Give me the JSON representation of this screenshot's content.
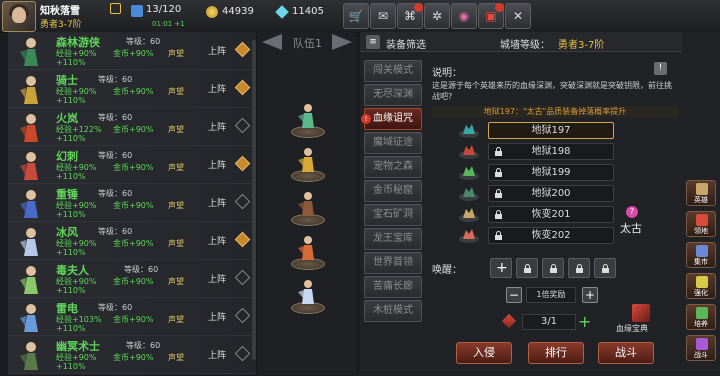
{
  "player": {
    "name": "知秋落雪",
    "difficulty": "勇者3-7阶",
    "energy": "13/120",
    "timer": "01:01 +1",
    "gold": "44939",
    "gems": "11405"
  },
  "toolbar": [
    "store",
    "mail",
    "gamepad",
    "settings",
    "palette",
    "gift",
    "tools"
  ],
  "heroes": [
    {
      "name": "森林游侠",
      "level": "等级：60",
      "exp": "经验+90%",
      "coin": "金币+90%",
      "fame": "声望",
      "extra": "+110%",
      "deploy": "上阵",
      "selected": true,
      "color": "#3a8a5a"
    },
    {
      "name": "骑士",
      "level": "等级：60",
      "exp": "经验+90%",
      "coin": "金币+90%",
      "fame": "声望",
      "extra": "+110%",
      "deploy": "上阵",
      "selected": true,
      "color": "#c9a23a"
    },
    {
      "name": "火岚",
      "level": "等级：60",
      "exp": "经验+122%",
      "coin": "金币+90%",
      "fame": "声望",
      "extra": "+110%",
      "deploy": "上阵",
      "selected": false,
      "color": "#c94a2a"
    },
    {
      "name": "幻刺",
      "level": "等级：60",
      "exp": "经验+90%",
      "coin": "金币+90%",
      "fame": "声望",
      "extra": "+110%",
      "deploy": "上阵",
      "selected": true,
      "color": "#c84a3a"
    },
    {
      "name": "重锤",
      "level": "等级：60",
      "exp": "经验+90%",
      "coin": "金币+90%",
      "fame": "声望",
      "extra": "+110%",
      "deploy": "上阵",
      "selected": false,
      "color": "#4a6ac8"
    },
    {
      "name": "冰风",
      "level": "等级：60",
      "exp": "经验+90%",
      "coin": "金币+90%",
      "fame": "声望",
      "extra": "+110%",
      "deploy": "上阵",
      "selected": true,
      "color": "#b8c8e8"
    },
    {
      "name": "毒夫人",
      "level": "等级：60",
      "exp": "经验+90%",
      "coin": "金币+90%",
      "fame": "声望",
      "extra": "+110%",
      "deploy": "上阵",
      "selected": false,
      "color": "#8ac86a"
    },
    {
      "name": "雷电",
      "level": "等级：60",
      "exp": "经验+103%",
      "coin": "金币+90%",
      "fame": "声望",
      "extra": "+110%",
      "deploy": "上阵",
      "selected": false,
      "color": "#6a9ad8"
    },
    {
      "name": "幽冥术士",
      "level": "等级：60",
      "exp": "经验+90%",
      "coin": "金币+90%",
      "fame": "声望",
      "extra": "+110%",
      "deploy": "上阵",
      "selected": false,
      "color": "#5a7a4a"
    }
  ],
  "team": {
    "label": "队伍1",
    "slots": [
      "#5ab88a",
      "#d8a83a",
      "#8a5a3a",
      "#d86a3a",
      "#c8d8f0"
    ]
  },
  "filter": {
    "label": "装备筛选",
    "city_level_label": "城墙等级：",
    "city_level": "勇者3-7阶"
  },
  "modes": [
    "闯关模式",
    "无尽深渊",
    "血缘诅咒",
    "魔域征途",
    "宠物之森",
    "金币秘窟",
    "宝石矿洞",
    "龙王宝库",
    "世界首领",
    "苦痛长廊",
    "木桩模式"
  ],
  "active_mode": 2,
  "desc": {
    "title": "说明：",
    "text": "这是源于每个英雄来历的血缘深渊，突破深渊就是突破钥限，前往挑战吧?",
    "drop": "地狱197：\"太古\"品质装备掉落概率提升"
  },
  "dungeons": [
    {
      "name": "地狱197",
      "locked": false,
      "selected": true,
      "color": "#3aa8a8"
    },
    {
      "name": "地狱198",
      "locked": true,
      "selected": false,
      "color": "#c84a3a"
    },
    {
      "name": "地狱199",
      "locked": true,
      "selected": false,
      "color": "#5ab85a"
    },
    {
      "name": "地狱200",
      "locked": true,
      "selected": false,
      "color": "#4a8a6a"
    },
    {
      "name": "恢变201",
      "locked": true,
      "selected": false,
      "color": "#c8a86a"
    },
    {
      "name": "恢变202",
      "locked": true,
      "selected": false,
      "color": "#d86a5a"
    }
  ],
  "quality": {
    "label": "太古",
    "badge": "?"
  },
  "wake": {
    "label": "唤醒："
  },
  "reward": {
    "label": "1倍奖励"
  },
  "count": {
    "value": "3/1"
  },
  "codex": {
    "label": "血缘宝典"
  },
  "actions": {
    "invade": "入侵",
    "queue": "排行",
    "fight": "战斗"
  },
  "sidebar": [
    "英雄",
    "领地",
    "集市",
    "强化",
    "培养",
    "战斗"
  ]
}
